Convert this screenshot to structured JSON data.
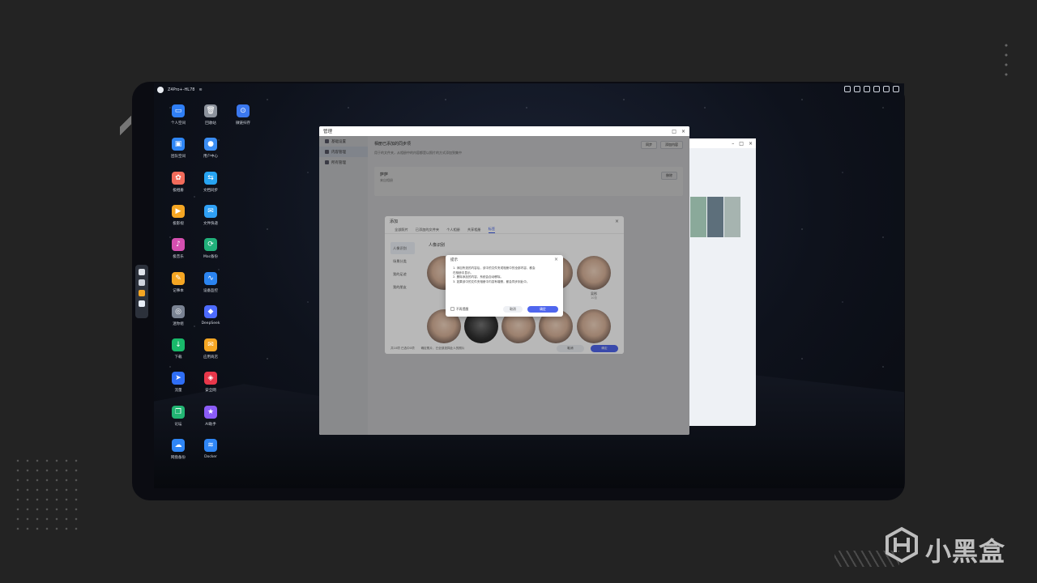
{
  "topbar": {
    "device": "Z4Pro+-HL78"
  },
  "desktop_icons": [
    {
      "label": "个人空间",
      "color": "#2f7ff5",
      "icon": "folder-icon"
    },
    {
      "label": "回收站",
      "color": "#8c929c",
      "icon": "trash-icon"
    },
    {
      "label": "微链扫存",
      "color": "#3b78ef",
      "icon": "link-icon"
    },
    {
      "label": "团队空间",
      "color": "#2f86f5",
      "icon": "team-icon"
    },
    {
      "label": "用户中心",
      "color": "#3b8df2",
      "icon": "user-icon"
    },
    {
      "label": "极相册",
      "color": "#f26b5b",
      "icon": "album-icon"
    },
    {
      "label": "文档同步",
      "color": "#27a4f2",
      "icon": "sync-icon"
    },
    {
      "label": "极影视",
      "color": "#f5a623",
      "icon": "video-icon"
    },
    {
      "label": "文件快递",
      "color": "#2fa0f5",
      "icon": "delivery-icon"
    },
    {
      "label": "极音乐",
      "color": "#d44fb0",
      "icon": "music-icon"
    },
    {
      "label": "Mac备份",
      "color": "#21b07a",
      "icon": "backup-icon"
    },
    {
      "label": "记事本",
      "color": "#f5a623",
      "icon": "note-icon"
    },
    {
      "label": "设备监控",
      "color": "#2b84f0",
      "icon": "monitor-icon"
    },
    {
      "label": "迷你组",
      "color": "#7a8393",
      "icon": "mini-icon"
    },
    {
      "label": "DeepSeek",
      "color": "#4d6bfe",
      "icon": "deepseek-icon"
    },
    {
      "label": "下载",
      "color": "#19b96a",
      "icon": "download-icon"
    },
    {
      "label": "应用商店",
      "color": "#f5a623",
      "icon": "store-icon"
    },
    {
      "label": "流量",
      "color": "#2f6ef5",
      "icon": "flow-icon"
    },
    {
      "label": "安全网",
      "color": "#e8374a",
      "icon": "shield-icon"
    },
    {
      "label": "论坛",
      "color": "#22b573",
      "icon": "forum-icon"
    },
    {
      "label": "AI助手",
      "color": "#8b5cf6",
      "icon": "ai-icon"
    },
    {
      "label": "网盘备份",
      "color": "#2f86f5",
      "icon": "cloud-icon"
    },
    {
      "label": "Docker",
      "color": "#2f86f5",
      "icon": "docker-icon"
    }
  ],
  "main_window": {
    "title": "管理",
    "side": [
      "基础设置",
      "内容管理",
      "所有管理"
    ],
    "head_title": "相册已添加的同步项",
    "head_sub": "用于的文件夹，从相册中的内容都是以照片的方式添加到集中",
    "btn_sync": "同步",
    "btn_add": "添加内容",
    "card_name": "萨萨",
    "card_desc": "来自相册",
    "card_remove": "移除"
  },
  "add_dialog": {
    "title": "添加",
    "tabs": [
      "全部照片",
      "已添加的文件夹",
      "个人相册",
      "共享相册",
      "标签"
    ],
    "side": [
      "人像识别",
      "场景分类",
      "我的足迹",
      "我的朋友"
    ],
    "faces_title": "人像识别",
    "face_label": "吴彤",
    "face_sub": "10张",
    "foot_count": "共10项 已选中0项",
    "foot_check": "确定照片，已全部选择此人的照片",
    "cancel": "取消",
    "ok": "确定"
  },
  "prompt": {
    "title": "提示",
    "lines": [
      "1. 添加所选的内容后，该中的文件夹或相册中的全部内容，都会",
      "在相册中显示。",
      "2. 删除添加的内容，系统会自动移除。",
      "3. 如果该中的文件夹相册中内容有增删，都会同步到此中。"
    ],
    "no_remind": "不再提醒",
    "cancel": "取消",
    "ok": "确定"
  },
  "watermark": {
    "text": "小黑盒"
  }
}
